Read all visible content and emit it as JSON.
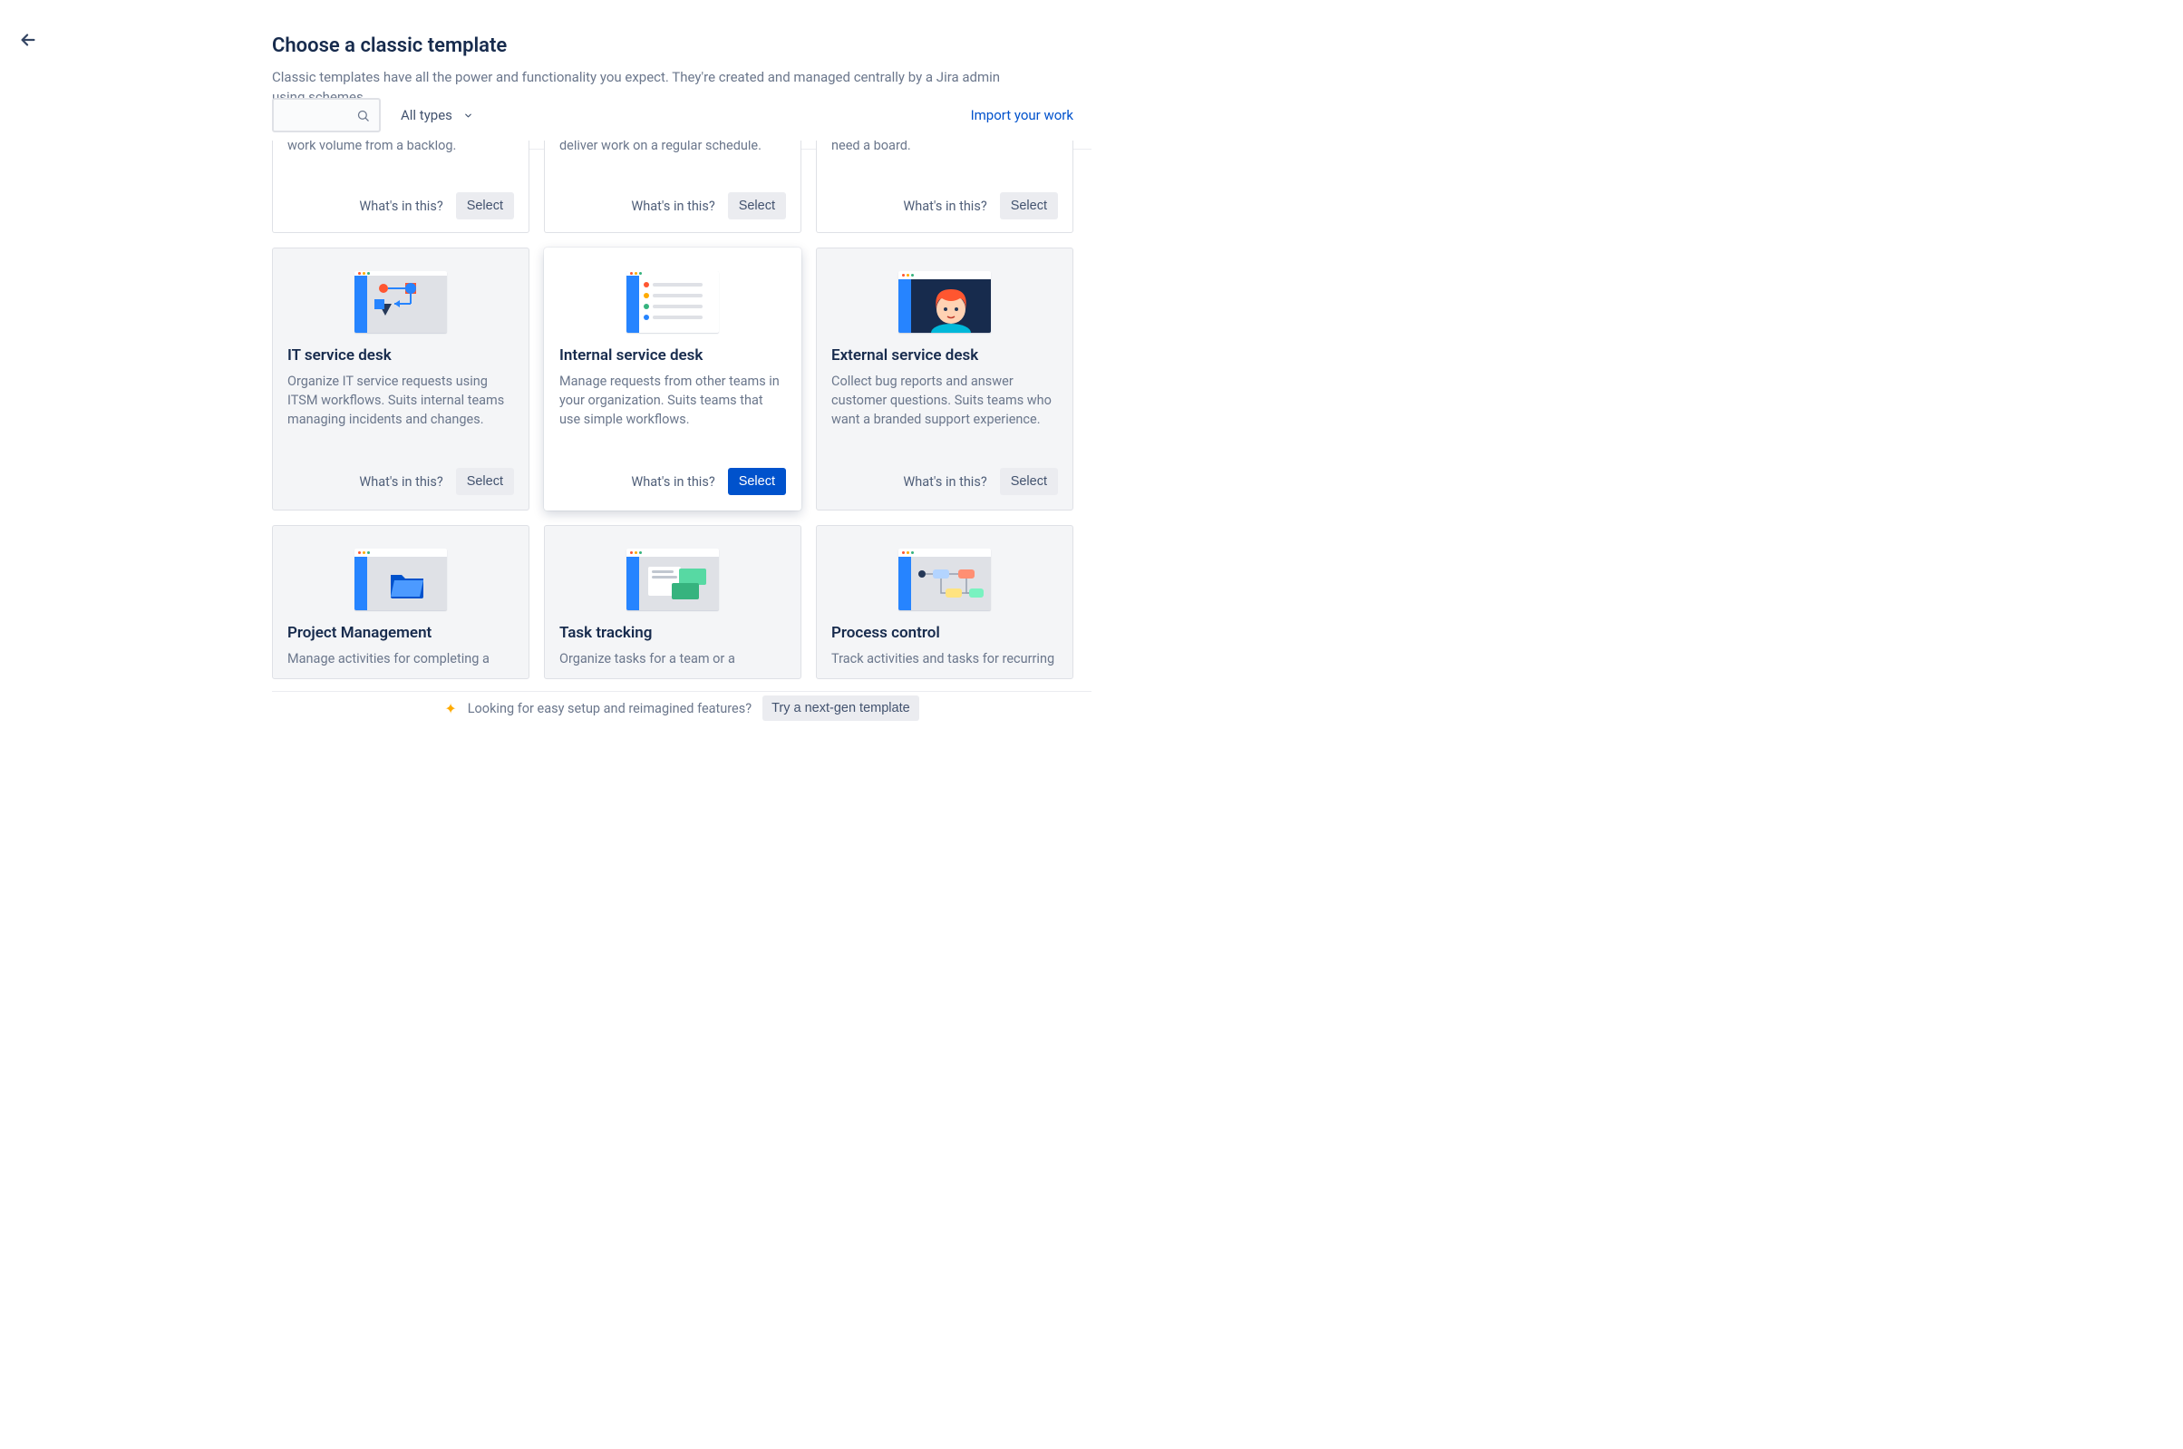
{
  "header": {
    "title": "Choose a classic template",
    "subtitle": "Classic templates have all the power and functionality you expect. They're created and managed centrally by a Jira admin using schemes."
  },
  "controls": {
    "type_filter": "All types",
    "import_link": "Import your work"
  },
  "top_fragments": [
    {
      "desc": "work volume from a backlog."
    },
    {
      "desc": "deliver work on a regular schedule."
    },
    {
      "desc": "need a board."
    }
  ],
  "row2": [
    {
      "title": "IT service desk",
      "desc": "Organize IT service requests using ITSM workflows. Suits internal teams managing incidents and changes.",
      "illus": "itsd",
      "highlighted": false
    },
    {
      "title": "Internal service desk",
      "desc": "Manage requests from other teams in your organization. Suits teams that use simple workflows.",
      "illus": "internal",
      "highlighted": true
    },
    {
      "title": "External service desk",
      "desc": "Collect bug reports and answer customer questions. Suits teams who want a branded support experience.",
      "illus": "external",
      "highlighted": false
    }
  ],
  "row3": [
    {
      "title": "Project Management",
      "desc": "Manage activities for completing a",
      "illus": "folder"
    },
    {
      "title": "Task tracking",
      "desc": "Organize tasks for a team or a",
      "illus": "tasks"
    },
    {
      "title": "Process control",
      "desc": "Track activities and tasks for recurring",
      "illus": "process"
    }
  ],
  "labels": {
    "whats": "What's in this?",
    "select": "Select"
  },
  "footer": {
    "text": "Looking for easy setup and reimagined features?",
    "cta": "Try a next-gen template"
  }
}
